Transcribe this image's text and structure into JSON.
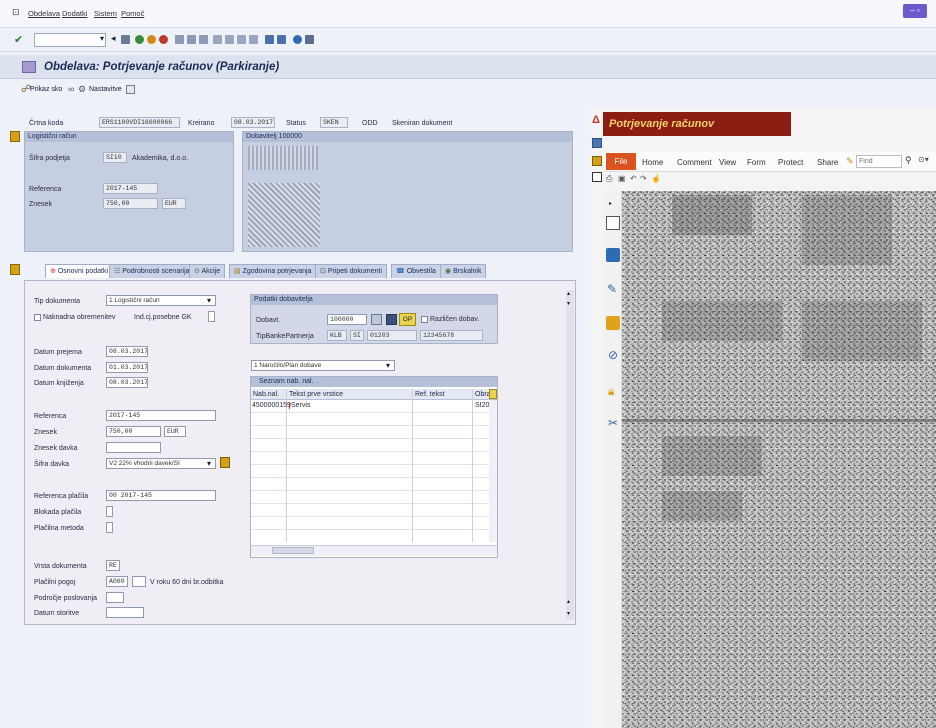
{
  "menu": {
    "items": [
      "Obdelava",
      "Dodatki",
      "Sistem",
      "Pomoč"
    ]
  },
  "page": {
    "title": "Obdelava: Potrjevanje računov (Parkiranje)"
  },
  "app_toolbar": {
    "show_object": "Prikaz sko",
    "settings": "Nastavitve"
  },
  "header": {
    "crtna_koda_label": "Črtna koda",
    "crtna_koda": "ERS1100VDI16000066",
    "kreirano_label": "Kreirano",
    "kreirano": "08.03.2017",
    "status_label": "Status",
    "status": "SKEN",
    "status_extra": "ODD",
    "status_text": "Skeniran dokument"
  },
  "logisticni": {
    "header": "Logistični račun",
    "sifra_podjetja_label": "Šifra podjetja",
    "sifra_podjetja": "SI10",
    "podjetje_name": "Akademika, d.o.o.",
    "referenca_label": "Referenca",
    "referenca": "2017-145",
    "znesek_label": "Znesek",
    "znesek": "750,00",
    "valuta": "EUR"
  },
  "dobavitelj_panel": {
    "header": "Dobavitelj 100000"
  },
  "tabs": [
    {
      "label": "Osnovni podatki"
    },
    {
      "label": "Podrobnosti scenarija"
    },
    {
      "label": "Akcije"
    },
    {
      "label": "Zgodovina potrjevanja"
    },
    {
      "label": "Pripeti dokumenti"
    },
    {
      "label": "Obvestila"
    },
    {
      "label": "Brskalnik"
    }
  ],
  "form": {
    "tip_dokumenta_label": "Tip dokumenta",
    "tip_dokumenta": "1 Logistični račun",
    "naknadna_label": "Naknadna obremenitev",
    "ind_label": "Ind.cj.posebne GK",
    "datum_prejema_label": "Datum prejema",
    "datum_prejema": "08.03.2017",
    "datum_dokumenta_label": "Datum dokumenta",
    "datum_dokumenta": "01.03.2017",
    "datum_knjizenja_label": "Datum knjiženja",
    "datum_knjizenja": "08.03.2017",
    "referenca_label": "Referenca",
    "referenca": "2017-145",
    "znesek_label": "Znesek",
    "znesek": "750,00",
    "valuta": "EUR",
    "znesek_davka_label": "Znesek davka",
    "sifra_davka_label": "Šifra davka",
    "sifra_davka": "V2 22% vhodni davek/SI",
    "referenca_placila_label": "Referenca plačila",
    "referenca_placila": "00 2017-145",
    "blokada_label": "Blokada plačila",
    "placilna_metoda_label": "Plačilna metoda",
    "vrsta_dokumenta_label": "Vrsta dokumenta",
    "vrsta_dokumenta": "RE",
    "placilni_pogoj_label": "Plačilni pogoj",
    "placilni_pogoj": "A060",
    "placilni_pogoj_text": "V roku 60 dni br.odbitka",
    "podrocje_label": "Področje poslovanja",
    "datum_storitve_label": "Datum storitve"
  },
  "dobavitelj": {
    "header": "Podatki dobavitelja",
    "dobavt_label": "Dobavt.",
    "dobavt": "100000",
    "op_label": "OP",
    "razlicen_label": "Različen dobav.",
    "tip_banke_label": "TipBankePartnerja",
    "banka": "KLB",
    "drzava": "SI",
    "stevilka": "01203",
    "racun": "12345678"
  },
  "narocila": {
    "select": "1 Naročilo/Plan dobave",
    "header": "Seznam nab. nal.",
    "columns": [
      "Nab.nal.",
      "Tekst prve vrstice",
      "Ref. tekst",
      "Obra"
    ],
    "rows": [
      [
        "4500000159",
        "Servis",
        "",
        "SI20"
      ]
    ]
  },
  "pdf": {
    "title": "Potrjevanje računov",
    "ribbon": [
      "File",
      "Home",
      "Comment",
      "View",
      "Form",
      "Protect",
      "Share"
    ],
    "find_placeholder": "Find"
  },
  "colors": {
    "pdf_header_bg": "#8b1d12",
    "pdf_header_fg": "#f6d36a",
    "file_tab": "#d9541e"
  }
}
